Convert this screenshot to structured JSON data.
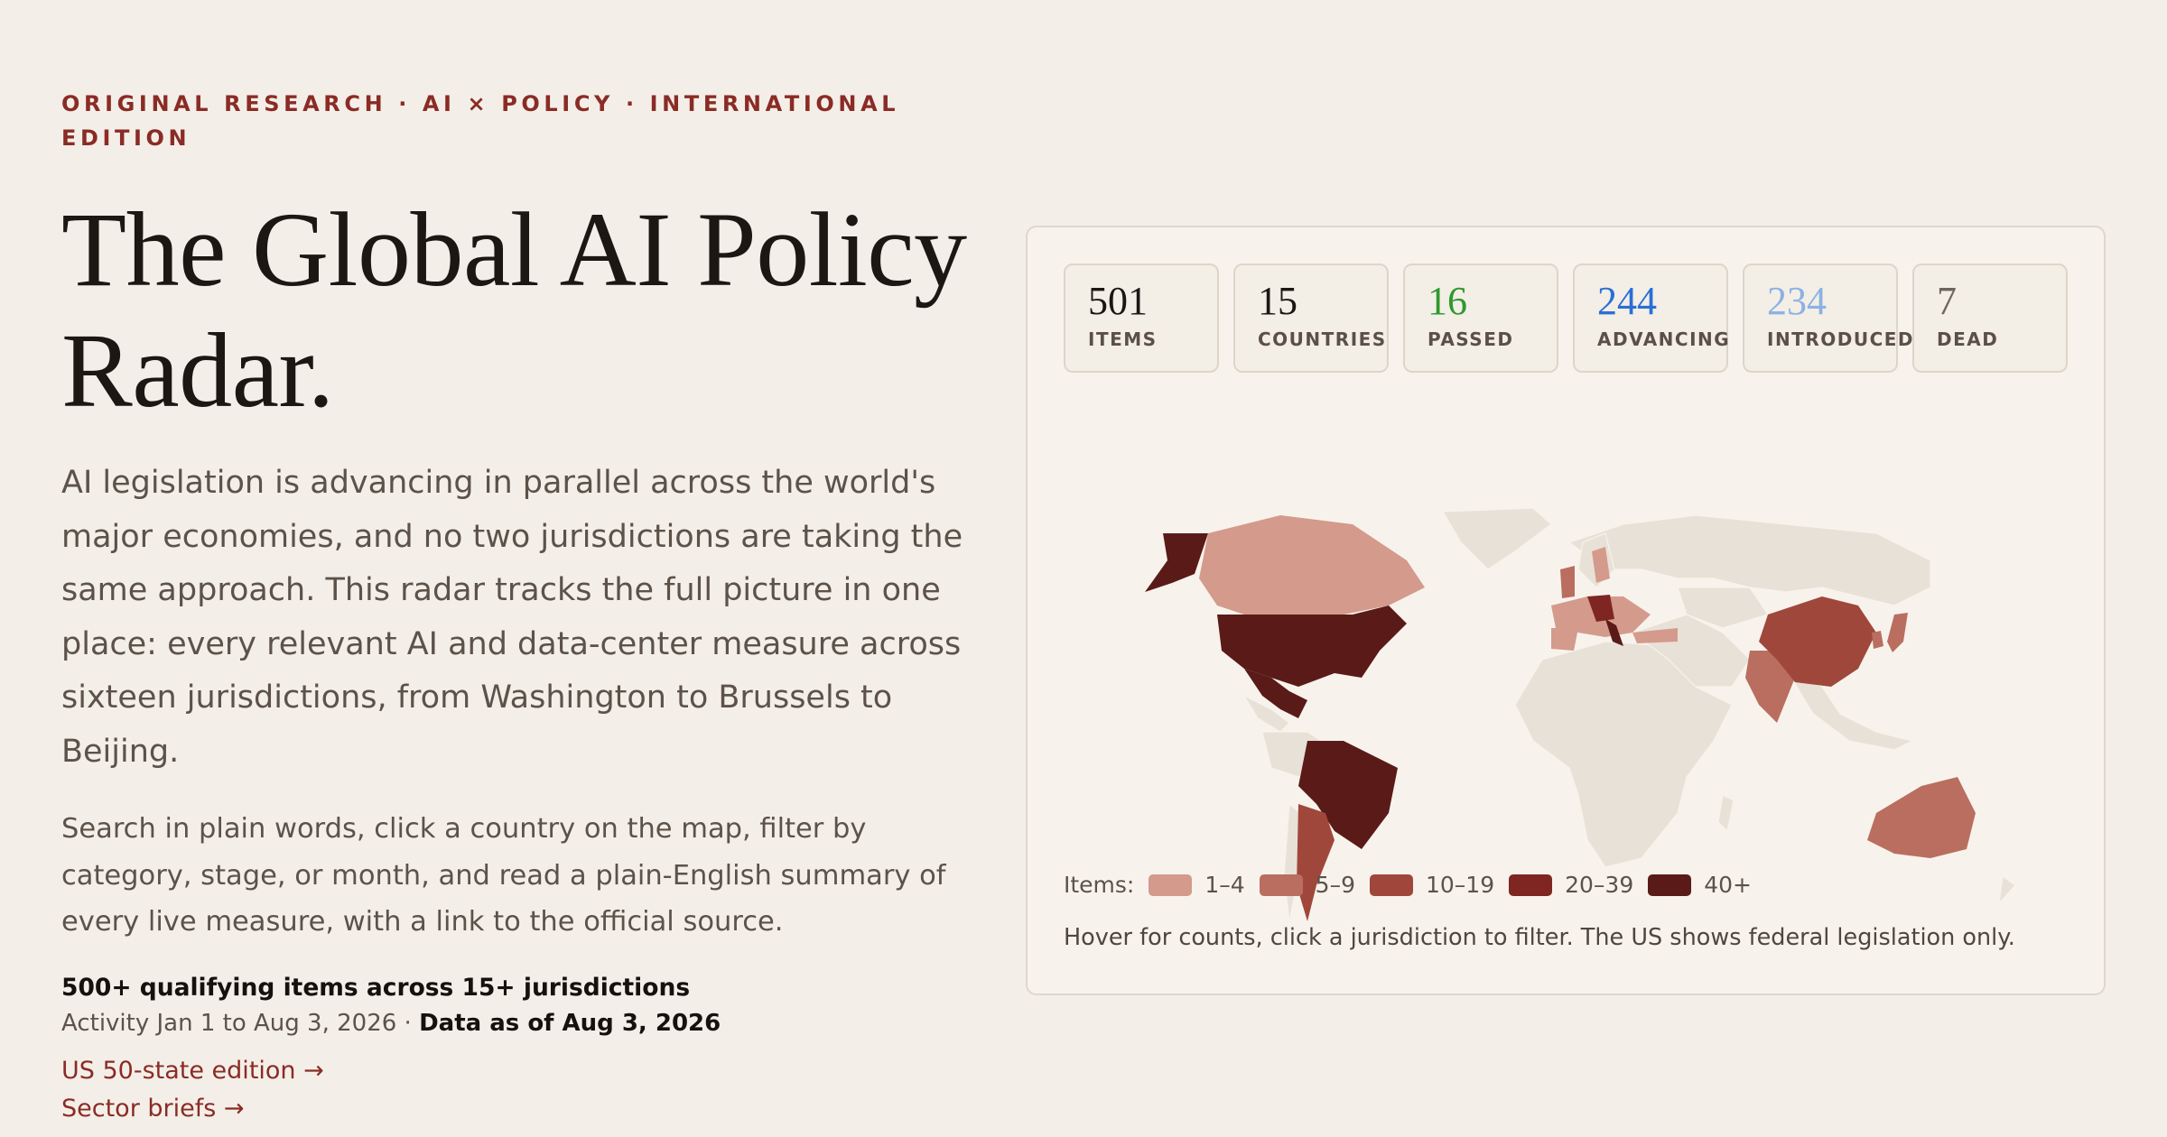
{
  "hero": {
    "kicker": "ORIGINAL RESEARCH · AI × POLICY · INTERNATIONAL EDITION",
    "title": "The Global AI Policy Radar.",
    "lede": "AI legislation is advancing in parallel across the world's major economies, and no two jurisdictions are taking the same approach. This radar tracks the full picture in one place: every relevant AI and data-center measure across sixteen jurisdictions, from Washington to Brussels to Beijing.",
    "body": "Search in plain words, click a country on the map, filter by category, stage, or month, and read a plain-English summary of every live measure, with a link to the official source.",
    "stats": "500+ qualifying items across 15+ jurisdictions",
    "activity": "Activity Jan 1 to Aug 3, 2026 · ",
    "data_as_of": "Data as of Aug 3, 2026",
    "links": [
      "US 50-state edition →",
      "Sector briefs →"
    ]
  },
  "stats_cards": [
    {
      "value": "501",
      "label": "ITEMS",
      "color": "#1b1713"
    },
    {
      "value": "15",
      "label": "COUNTRIES",
      "color": "#1b1713"
    },
    {
      "value": "16",
      "label": "PASSED",
      "color": "#2e9a2e"
    },
    {
      "value": "244",
      "label": "ADVANCING",
      "color": "#2a6fd6"
    },
    {
      "value": "234",
      "label": "INTRODUCED",
      "color": "#8cb2e4"
    },
    {
      "value": "7",
      "label": "DEAD",
      "color": "#6d645b"
    }
  ],
  "legend": {
    "label": "Items:",
    "bins": [
      {
        "label": "1–4",
        "color": "#d49a8c"
      },
      {
        "label": "5–9",
        "color": "#ba6e60"
      },
      {
        "label": "10–19",
        "color": "#a0473b"
      },
      {
        "label": "20–39",
        "color": "#7f2622"
      },
      {
        "label": "40+",
        "color": "#5a1b18"
      }
    ]
  },
  "note": "Hover for counts, click a jurisdiction to filter. The US shows federal legislation only.",
  "colors": {
    "land": "#e8e1d7",
    "accent": "#8b2b25",
    "background": "#f3efe8"
  }
}
